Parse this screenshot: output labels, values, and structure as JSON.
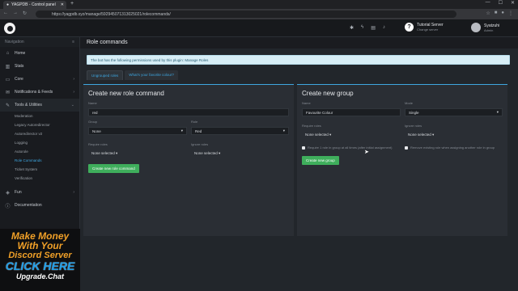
{
  "browser": {
    "tab_title": "YAGPDB - Control panel",
    "url": "https://yagpdb.xyz/manage/592945071313025021/rolecommands/"
  },
  "topbar": {
    "server_name": "Tutorial Server",
    "server_sub": "Change server",
    "user_name": "Syatzuhi",
    "user_sub": "Admin"
  },
  "sidebar": {
    "header": "Navigation",
    "items": [
      {
        "label": "Home",
        "icon": "home-icon"
      },
      {
        "label": "Stats",
        "icon": "stats-icon"
      },
      {
        "label": "Core",
        "icon": "core-icon"
      },
      {
        "label": "Notifications & Feeds",
        "icon": "bell-icon"
      },
      {
        "label": "Tools & Utilities",
        "icon": "wrench-icon"
      }
    ],
    "subitems": [
      "Moderation",
      "Legacy Autoredirector",
      "Autoredirector v2",
      "Logging",
      "Autorole",
      "Role Commands",
      "Ticket System",
      "Verification"
    ],
    "bottom_items": [
      {
        "label": "Fun",
        "icon": "gamepad-icon"
      },
      {
        "label": "Documentation",
        "icon": "info-icon"
      }
    ]
  },
  "promo": {
    "line1": "Make Money",
    "line2": "With Your",
    "line3": "Discord Server",
    "line4": "CLICK HERE",
    "line5": "Upgrade.Chat"
  },
  "page": {
    "title": "Role commands",
    "alert": "The bot has the following permissions used by this plugin: Manage Roles",
    "tabs": [
      "Ungrouped roles",
      "What's your favorite colour?"
    ]
  },
  "create_command": {
    "heading": "Create new role command",
    "name_label": "Name",
    "name_value": "red",
    "group_label": "Group",
    "group_value": "None",
    "role_label": "Role",
    "role_value": "Red",
    "require_label": "Require roles",
    "require_value": "None selected",
    "ignore_label": "Ignore roles",
    "ignore_value": "None selected",
    "button": "Create new role command"
  },
  "create_group": {
    "heading": "Create new group",
    "name_label": "Name",
    "name_value": "Favourite Colour",
    "mode_label": "Mode",
    "mode_value": "Single",
    "require_label": "Require roles",
    "require_value": "None selected",
    "ignore_label": "Ignore roles",
    "ignore_value": "None selected",
    "check1": "Require 1 role in group at all times (after initial assignment)",
    "check2": "Remove existing role when assigning another role in group",
    "button": "Create new group"
  },
  "colors": {
    "accent": "#3ea6e0",
    "button_green": "#3fae5c",
    "promo_orange": "#f0a028"
  }
}
